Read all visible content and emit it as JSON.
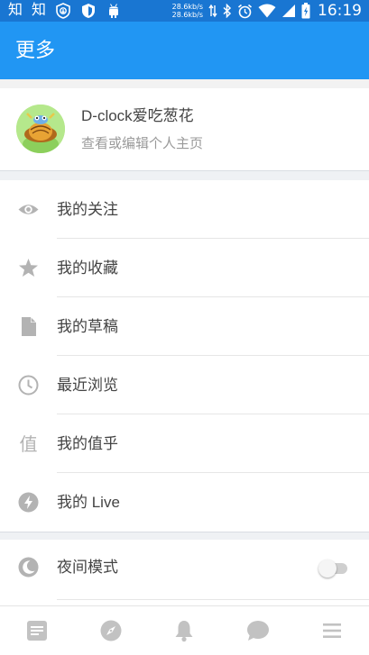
{
  "status_bar": {
    "left_texts": [
      "知",
      "知"
    ],
    "net_up": "28.6kb/s",
    "net_down": "28.6kb/s",
    "time": "16:19"
  },
  "app_bar": {
    "title": "更多"
  },
  "profile": {
    "name": "D-clock爱吃葱花",
    "subtitle": "查看或编辑个人主页"
  },
  "menu_group_1": [
    {
      "label": "我的关注",
      "icon": "eye-icon"
    },
    {
      "label": "我的收藏",
      "icon": "star-icon"
    },
    {
      "label": "我的草稿",
      "icon": "file-icon"
    },
    {
      "label": "最近浏览",
      "icon": "clock-icon"
    },
    {
      "label": "我的值乎",
      "icon": "zhi-icon",
      "icon_text": "值"
    },
    {
      "label": "我的 Live",
      "icon": "lightning-icon"
    }
  ],
  "menu_group_2": [
    {
      "label": "夜间模式",
      "icon": "moon-icon",
      "toggle_on": false
    }
  ],
  "bottom_tabs": [
    "home-feed-icon",
    "compass-icon",
    "bell-icon",
    "chat-bubble-icon",
    "menu-icon"
  ],
  "colors": {
    "status_bar": "#1976d2",
    "app_bar": "#2196f3",
    "icon_gray": "#b3b3b3",
    "divider_bg": "#eff1f4"
  }
}
